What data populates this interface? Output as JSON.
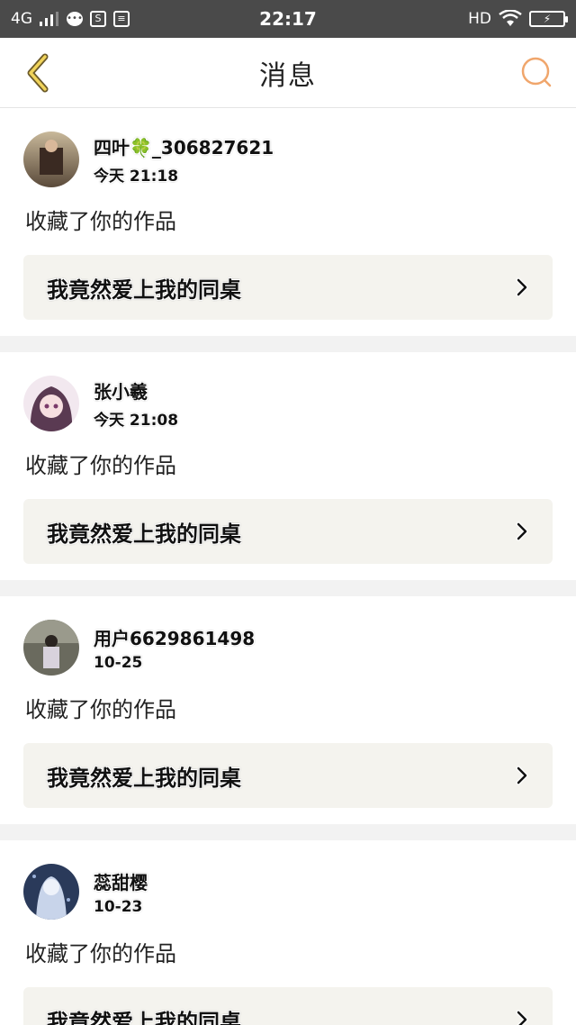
{
  "status_bar": {
    "network": "4G",
    "time": "22:17",
    "hd": "HD"
  },
  "nav": {
    "title": "消息"
  },
  "messages": [
    {
      "user": "四叶🍀_306827621",
      "time": "今天 21:18",
      "action": "收藏了你的作品",
      "work": "我竟然爱上我的同桌"
    },
    {
      "user": "张小羲",
      "time": "今天 21:08",
      "action": "收藏了你的作品",
      "work": "我竟然爱上我的同桌"
    },
    {
      "user": "用户6629861498",
      "time": "10-25",
      "action": "收藏了你的作品",
      "work": "我竟然爱上我的同桌"
    },
    {
      "user": "蕊甜樱",
      "time": "10-23",
      "action": "收藏了你的作品",
      "work": "我竟然爱上我的同桌"
    }
  ],
  "colors": {
    "accent": "#e6a23c",
    "search_accent": "#f0a66c",
    "status_bg": "#4a4a4a",
    "card_link_bg": "#f4f3ee"
  },
  "icons": [
    "back-chevron-icon",
    "search-icon",
    "chevron-right-icon"
  ]
}
